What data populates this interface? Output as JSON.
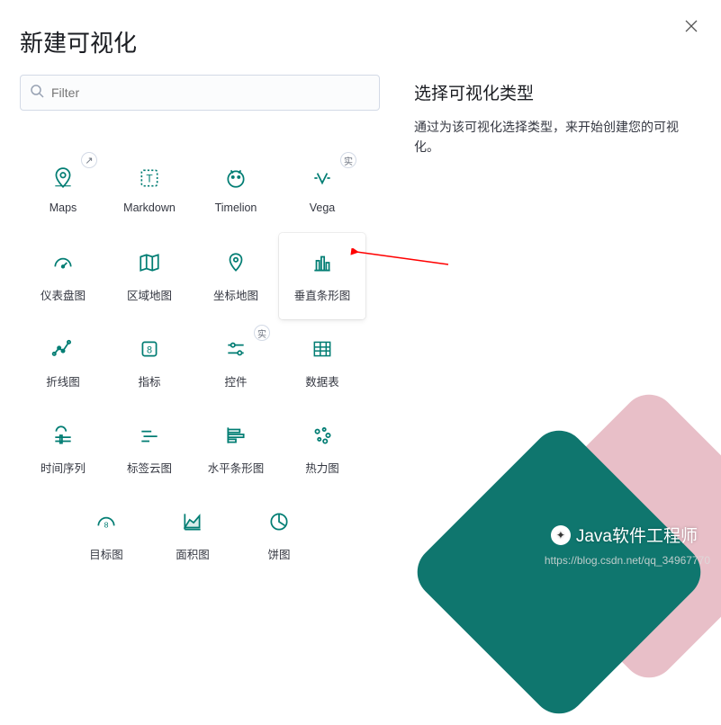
{
  "title": "新建可视化",
  "close_label": "close",
  "search": {
    "placeholder": "Filter"
  },
  "badges": {
    "experimental": "实",
    "external": "↗"
  },
  "tiles": {
    "row1": [
      {
        "id": "maps",
        "label": "Maps",
        "badge": "external"
      },
      {
        "id": "markdown",
        "label": "Markdown"
      },
      {
        "id": "timelion",
        "label": "Timelion"
      },
      {
        "id": "vega",
        "label": "Vega",
        "badge": "experimental"
      }
    ],
    "row2": [
      {
        "id": "gauge",
        "label": "仪表盘图"
      },
      {
        "id": "region-map",
        "label": "区域地图"
      },
      {
        "id": "coordinate-map",
        "label": "坐标地图"
      },
      {
        "id": "vertical-bar",
        "label": "垂直条形图",
        "highlight": true
      }
    ],
    "row3": [
      {
        "id": "line",
        "label": "折线图"
      },
      {
        "id": "metric",
        "label": "指标"
      },
      {
        "id": "controls",
        "label": "控件",
        "badge": "experimental"
      },
      {
        "id": "data-table",
        "label": "数据表"
      }
    ],
    "row4": [
      {
        "id": "tsvb",
        "label": "时间序列"
      },
      {
        "id": "tag-cloud",
        "label": "标签云图"
      },
      {
        "id": "horizontal-bar",
        "label": "水平条形图"
      },
      {
        "id": "heatmap",
        "label": "热力图"
      }
    ],
    "row5": [
      {
        "id": "goal",
        "label": "目标图"
      },
      {
        "id": "area",
        "label": "面积图"
      },
      {
        "id": "pie",
        "label": "饼图"
      }
    ]
  },
  "side": {
    "title": "选择可视化类型",
    "description": "通过为该可视化选择类型，来开始创建您的可视化。"
  },
  "watermark": {
    "text": "Java软件工程师"
  },
  "url_mark": "https://blog.csdn.net/qq_34967770",
  "colors": {
    "accent": "#017d73"
  }
}
